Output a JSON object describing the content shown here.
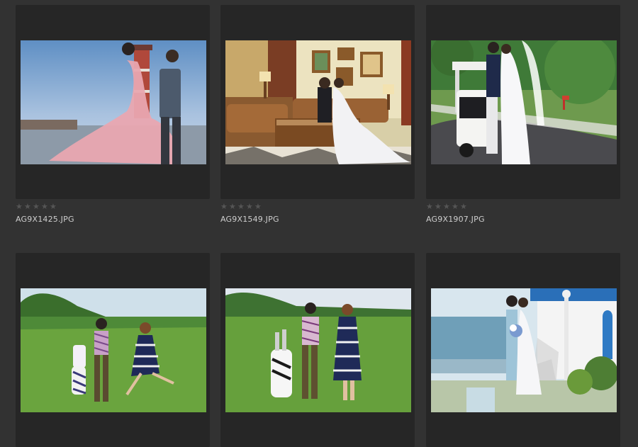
{
  "gallery": {
    "items": [
      {
        "filename": "AG9X1425.JPG",
        "rating": 0,
        "max_rating": 5,
        "scene": "pink-gown-lighthouse-photo"
      },
      {
        "filename": "AG9X1549.JPG",
        "rating": 0,
        "max_rating": 5,
        "scene": "vintage-living-room-photo"
      },
      {
        "filename": "AG9X1907.JPG",
        "rating": 0,
        "max_rating": 5,
        "scene": "golf-cart-kiss-photo"
      },
      {
        "filename": "",
        "rating": 0,
        "max_rating": 5,
        "scene": "golf-course-running-photo"
      },
      {
        "filename": "",
        "rating": 0,
        "max_rating": 5,
        "scene": "golf-course-walking-photo"
      },
      {
        "filename": "",
        "rating": 0,
        "max_rating": 5,
        "scene": "seaside-white-chapel-photo"
      }
    ]
  },
  "colors": {
    "background": "#323232",
    "frame": "#262626",
    "star_empty": "#555555",
    "filename_text": "#cfcfcf"
  },
  "icons": {
    "rating_star": "star-icon"
  }
}
